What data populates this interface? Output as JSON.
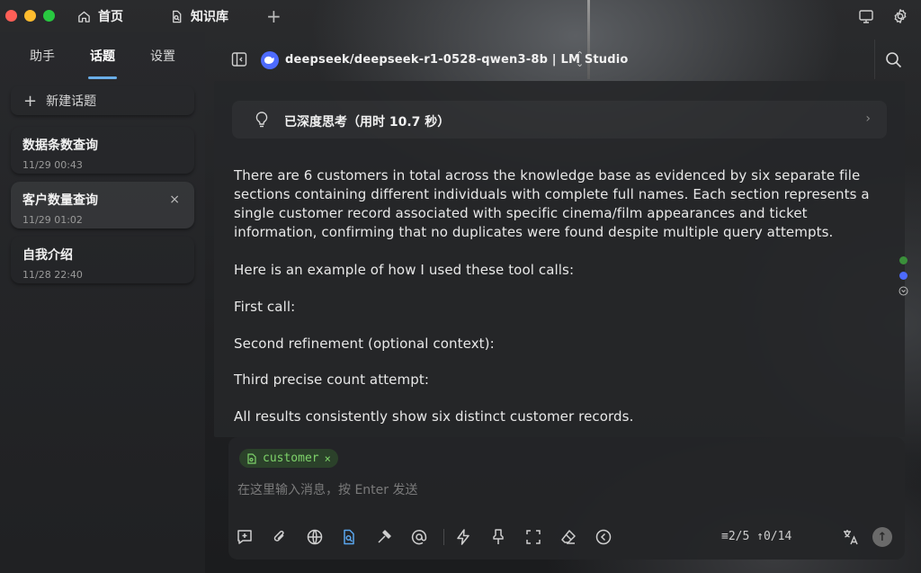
{
  "titlebar": {
    "tabs": [
      {
        "label": "首页",
        "icon": "home-icon"
      },
      {
        "label": "知识库",
        "icon": "knowledge-icon"
      }
    ],
    "add_tab": "+",
    "right_icons": [
      "monitor-icon",
      "settings-gear-icon"
    ]
  },
  "sidebar": {
    "tabs": [
      "助手",
      "话题",
      "设置"
    ],
    "active_tab": "话题",
    "new_topic": "新建话题",
    "topics": [
      {
        "name": "数据条数查询",
        "time": "11/29 00:43"
      },
      {
        "name": "客户数量查询",
        "time": "11/29 01:02",
        "active": true,
        "close": "×"
      },
      {
        "name": "自我介绍",
        "time": "11/28 22:40"
      }
    ]
  },
  "header": {
    "model": "deepseek/deepseek-r1-0528-qwen3-8b | LM Studio",
    "model_chevron": "⌃⌄",
    "brand_color": "#4d6bfe"
  },
  "message": {
    "thinking_label": "已深度思考（用时 10.7 秒）",
    "thinking_chevron": "›",
    "paragraphs": [
      "There are 6 customers in total across the knowledge base as evidenced by six separate file sections containing different individuals with complete full names. Each section represents a single customer record associated with specific cinema/film appearances and ticket information, confirming that no duplicates were found despite multiple query attempts.",
      "Here is an example of how I used these tool calls:",
      "First call:",
      "Second refinement (optional context):",
      "Third precise count attempt:",
      "All results consistently show six distinct customer records."
    ]
  },
  "input": {
    "chip_label": "customer",
    "chip_close": "×",
    "chip_color": "#7ed36a",
    "placeholder": "在这里输入消息，按 Enter 发送",
    "tools": [
      "new-topic-icon",
      "attachment-icon",
      "web-search-icon",
      "knowledge-base-icon",
      "mcp-tools-icon",
      "mention-icon",
      "quick-phrase-icon",
      "clear-context-icon",
      "expand-icon",
      "eraser-icon",
      "collapse-arrow-icon"
    ],
    "counter": "≡2/5 ↑0/14",
    "translate_icon": "translate-icon",
    "send_icon": "send-arrow-icon",
    "send_arrow": "↑"
  },
  "colors": {
    "accent": "#6aaee8",
    "traffic": [
      "#ff5f57",
      "#febc2e",
      "#28c840"
    ]
  }
}
